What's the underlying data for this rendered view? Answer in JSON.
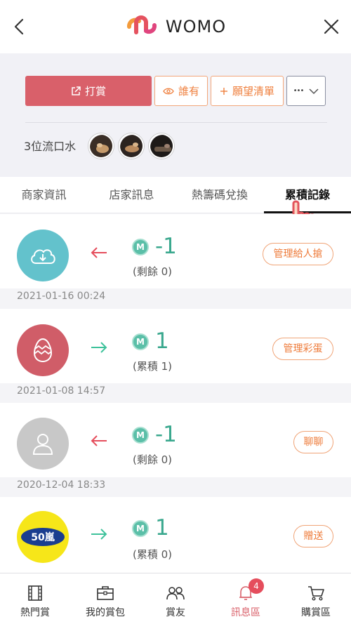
{
  "header": {
    "brand": "WOMO",
    "back_icon": "back-arrow-icon",
    "close_icon": "close-icon"
  },
  "actions": {
    "reward_label": "打賞",
    "who_label": "誰有",
    "wishlist_label": "願望清單",
    "more_label": "•••"
  },
  "drool": {
    "text": "3位流口水",
    "avatar_count": 3
  },
  "tabs": [
    {
      "label": "商家資訊"
    },
    {
      "label": "店家訊息"
    },
    {
      "label": "熱籌碼兌換"
    },
    {
      "label": "累積記錄"
    }
  ],
  "records": [
    {
      "icon": "cloud-download-icon",
      "direction": "out",
      "amount": "-1",
      "sub": "(剩餘 0)",
      "action": "管理給人搶",
      "date": "2021-01-16 00:24"
    },
    {
      "icon": "egg-icon",
      "direction": "in",
      "amount": "1",
      "sub": "(累積 1)",
      "action": "管理彩蛋",
      "date": "2021-01-08 14:57"
    },
    {
      "icon": "user-icon",
      "direction": "out",
      "amount": "-1",
      "sub": "(剩餘 0)",
      "action": "聊聊",
      "date": "2020-12-04 18:33"
    },
    {
      "icon": "brand-logo-icon",
      "logo_text": "50嵐",
      "direction": "in",
      "amount": "1",
      "sub": "(累積 0)",
      "action": "贈送"
    }
  ],
  "bottom_nav": [
    {
      "label": "熱門賞",
      "icon": "film-icon"
    },
    {
      "label": "我的賞包",
      "icon": "briefcase-icon"
    },
    {
      "label": "賞友",
      "icon": "friends-icon"
    },
    {
      "label": "訊息區",
      "icon": "bell-icon",
      "badge": "4"
    },
    {
      "label": "購賞區",
      "icon": "cart-icon"
    }
  ],
  "colors": {
    "primary": "#d9606a",
    "accent_orange": "#ee7b3a",
    "coin_green": "#3aa88e",
    "arrow_out": "#e54d5c",
    "arrow_in": "#3ec29b"
  }
}
